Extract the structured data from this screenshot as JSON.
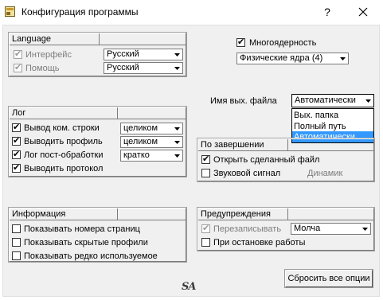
{
  "window": {
    "title": "Конфигурация программы",
    "help_glyph": "?",
    "close_glyph": "✕"
  },
  "language": {
    "header": "Language",
    "interface": {
      "label": "Интерфейс",
      "checked": true,
      "value": "Русский"
    },
    "help": {
      "label": "Помощь",
      "checked": true,
      "value": "Русский"
    }
  },
  "multicore": {
    "label": "Многоядерность",
    "checked": true,
    "value": "Физические ядра (4)"
  },
  "output_name": {
    "label": "Имя вых. файла",
    "value": "Автоматически",
    "options": [
      "Вых. папка",
      "Полный путь",
      "Автоматически"
    ],
    "selected_index": 2
  },
  "log": {
    "header": "Лог",
    "items": [
      {
        "label": "Вывод ком. строки",
        "checked": true,
        "value": "целиком"
      },
      {
        "label": "Выводить профиль",
        "checked": true,
        "value": "целиком"
      },
      {
        "label": "Лог пост-обработки",
        "checked": true,
        "value": "кратко"
      },
      {
        "label": "Выводить протокол",
        "checked": true
      }
    ]
  },
  "on_finish": {
    "header": "По завершении",
    "open_file": {
      "label": "Открыть сделанный файл",
      "checked": true
    },
    "sound": {
      "label": "Звуковой сигнал",
      "checked": false,
      "extra": "Динамик"
    }
  },
  "info": {
    "header": "Информация",
    "items": [
      {
        "label": "Показывать номера страниц",
        "checked": false
      },
      {
        "label": "Показывать скрытые профили",
        "checked": false
      },
      {
        "label": "Показывать редко используемое",
        "checked": false
      }
    ]
  },
  "warnings": {
    "header": "Предупреждения",
    "overwrite": {
      "label": "Перезаписывать",
      "checked": true,
      "value": "Молча"
    },
    "on_stop": {
      "label": "При остановке работы",
      "checked": false
    }
  },
  "logo_text": "SA",
  "reset_button": "Сбросить все опции",
  "colors": {
    "selection": "#3399ff",
    "dialog_bg": "#f0f0f0"
  }
}
